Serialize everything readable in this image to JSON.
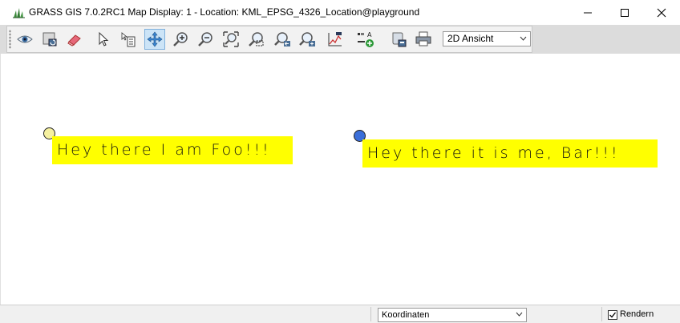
{
  "window": {
    "title": "GRASS GIS 7.0.2RC1 Map Display: 1  - Location: KML_EPSG_4326_Location@playground",
    "icon": "grass-app-icon",
    "controls": [
      "minimize-icon",
      "maximize-icon",
      "close-icon"
    ]
  },
  "toolbar": {
    "tools": [
      {
        "name": "display-map",
        "icon": "eye-icon"
      },
      {
        "name": "render-map",
        "icon": "render-icon"
      },
      {
        "name": "erase-display",
        "icon": "eraser-icon"
      },
      {
        "name": "pointer",
        "icon": "pointer-icon"
      },
      {
        "name": "query",
        "icon": "query-icon"
      },
      {
        "name": "pan",
        "icon": "pan-icon",
        "active": true
      },
      {
        "name": "zoom-in",
        "icon": "zoom-in-icon"
      },
      {
        "name": "zoom-out",
        "icon": "zoom-out-icon"
      },
      {
        "name": "zoom-extent",
        "icon": "zoom-extent-icon"
      },
      {
        "name": "zoom-region",
        "icon": "zoom-region-icon"
      },
      {
        "name": "zoom-back",
        "icon": "zoom-back-icon"
      },
      {
        "name": "zoom-options",
        "icon": "zoom-options-icon"
      },
      {
        "name": "analyze",
        "icon": "analyze-icon"
      },
      {
        "name": "decorations",
        "icon": "overlay-icon"
      },
      {
        "name": "save-image",
        "icon": "save-image-icon"
      },
      {
        "name": "print",
        "icon": "print-icon"
      }
    ],
    "view_mode": "2D Ansicht"
  },
  "map": {
    "labels": [
      {
        "text": "Hey there I am Foo!!!",
        "point_color": "#f5f0a0"
      },
      {
        "text": "Hey there it is me, Bar!!!",
        "point_color": "#3b6fd9"
      }
    ],
    "label_background": "#ffff00"
  },
  "statusbar": {
    "mode": "Koordinaten",
    "render_label": "Rendern",
    "render_checked": true
  }
}
